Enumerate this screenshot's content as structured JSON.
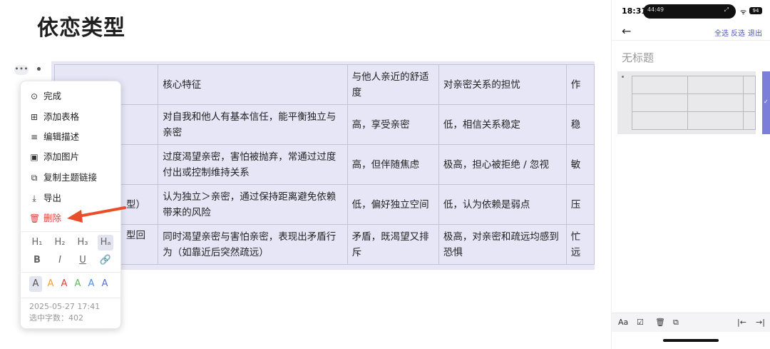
{
  "doc": {
    "title": "依恋类型",
    "outline_dots": "•••"
  },
  "table": {
    "rows": [
      [
        "",
        "核心特征",
        "与他人亲近的舒适度",
        "对亲密关系的担忧",
        "作"
      ],
      [
        "",
        "对自我和他人有基本信任，能平衡独立与亲密",
        "高，享受亲密",
        "低，相信关系稳定",
        "稳"
      ],
      [
        "",
        "过度渴望亲密，害怕被抛弃，常通过过度付出或控制维持关系",
        "高，但伴随焦虑",
        "极高，担心被拒绝 / 忽视",
        "敏"
      ],
      [
        "型）",
        "认为独立＞亲密，通过保持距离避免依赖带来的风险",
        "低，偏好独立空间",
        "低，认为依赖是弱点",
        "压"
      ],
      [
        "型回",
        "同时渴望亲密与害怕亲密，表现出矛盾行为（如靠近后突然疏远）",
        "矛盾，既渴望又排斥",
        "极高，对亲密和疏远均感到恐惧",
        "忙远"
      ]
    ]
  },
  "menu": {
    "items": [
      {
        "icon": "⊙",
        "label": "完成"
      },
      {
        "icon": "⊞",
        "label": "添加表格"
      },
      {
        "icon": "≡",
        "label": "编辑描述"
      },
      {
        "icon": "▣",
        "label": "添加图片"
      },
      {
        "icon": "⧉",
        "label": "复制主题链接"
      },
      {
        "icon": "⤓",
        "label": "导出"
      },
      {
        "icon": "🗑",
        "label": "删除"
      }
    ],
    "headings": [
      "H₁",
      "H₂",
      "H₃",
      "Hₐ"
    ],
    "styles": [
      "B",
      "I",
      "U",
      "🔗"
    ],
    "colors": [
      {
        "label": "A",
        "color": "#555555"
      },
      {
        "label": "A",
        "color": "#f0a030"
      },
      {
        "label": "A",
        "color": "#e0403a"
      },
      {
        "label": "A",
        "color": "#5cb85c"
      },
      {
        "label": "A",
        "color": "#4a90e2"
      },
      {
        "label": "A",
        "color": "#5a6fd6"
      }
    ],
    "timestamp": "2025-05-27 17:41",
    "word_count": "选中字数：402"
  },
  "phone": {
    "time": "18:31",
    "island_text": "44:49",
    "battery": "94",
    "actions": [
      "全选",
      "反选",
      "退出"
    ],
    "untitled": "无标题",
    "toolbar": {
      "font": "Aa",
      "check": "☑",
      "delete": "🗑",
      "copy": "⧉",
      "outdent": "|←",
      "indent": "→|"
    }
  },
  "colors": {
    "accent": "#5a5fd6",
    "danger": "#e0403a",
    "arrow": "#ea4d2a",
    "table_bg": "#e6e6f7"
  }
}
